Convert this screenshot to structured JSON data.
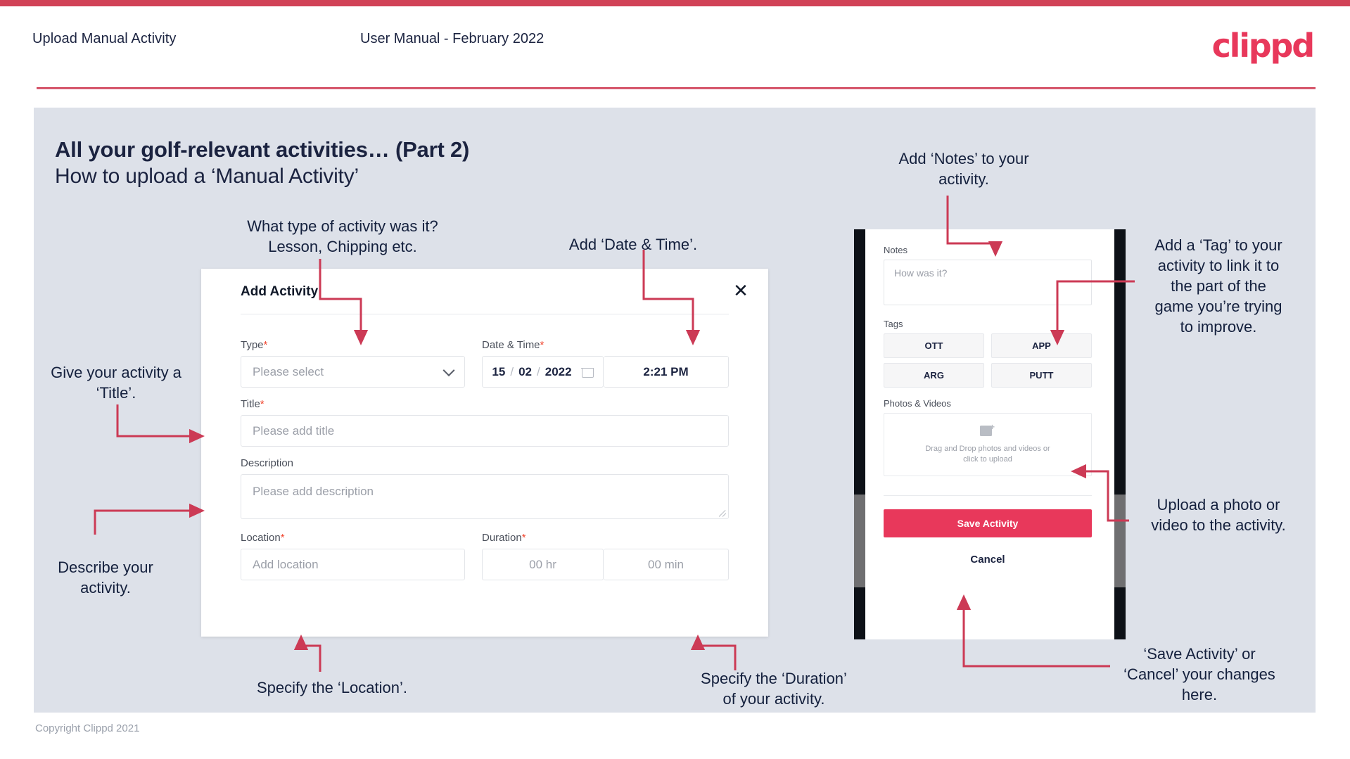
{
  "header": {
    "title": "Upload Manual Activity",
    "subtitle": "User Manual - February 2022",
    "logo": "clippd"
  },
  "slide": {
    "title": "All your golf-relevant activities… (Part 2)",
    "subtitle": "How to upload a ‘Manual Activity’",
    "copyright": "Copyright Clippd 2021"
  },
  "colors": {
    "brand_pink": "#e8385b",
    "rule_red": "#d14257",
    "slide_bg": "#dde1e9",
    "text_dark": "#1b2340",
    "required_star": "#f0452e"
  },
  "dialog": {
    "title": "Add Activity",
    "close_icon": "close-icon",
    "fields": {
      "type": {
        "label": "Type",
        "required": "*",
        "placeholder": "Please select",
        "chevron_icon": "chevron-down-icon"
      },
      "datetime": {
        "label": "Date & Time",
        "required": "*",
        "day": "15",
        "month": "02",
        "year": "2022",
        "sep": "/",
        "calendar_icon": "calendar-icon",
        "time": "2:21 PM"
      },
      "title": {
        "label": "Title",
        "required": "*",
        "placeholder": "Please add title"
      },
      "description": {
        "label": "Description",
        "required": "",
        "placeholder": "Please add description"
      },
      "location": {
        "label": "Location",
        "required": "*",
        "placeholder": "Add location"
      },
      "duration": {
        "label": "Duration",
        "required": "*",
        "hours_placeholder": "00 hr",
        "minutes_placeholder": "00 min"
      }
    }
  },
  "phone": {
    "notes": {
      "label": "Notes",
      "placeholder": "How was it?"
    },
    "tags": {
      "label": "Tags",
      "items": [
        "OTT",
        "APP",
        "ARG",
        "PUTT"
      ]
    },
    "photos": {
      "label": "Photos & Videos",
      "icon": "add-image-icon",
      "dropzone_line1": "Drag and Drop photos and videos or",
      "dropzone_line2": "click to upload"
    },
    "save_label": "Save Activity",
    "cancel_label": "Cancel"
  },
  "annotations": {
    "type": "What type of activity was it?\nLesson, Chipping etc.",
    "datetime": "Add ‘Date & Time’.",
    "title": "Give your activity a\n‘Title’.",
    "description": "Describe your\nactivity.",
    "location": "Specify the ‘Location’.",
    "duration": "Specify the ‘Duration’\nof your activity.",
    "notes": "Add ‘Notes’ to your\nactivity.",
    "tags": "Add a ‘Tag’ to your\nactivity to link it to\nthe part of the\ngame you’re trying\nto improve.",
    "photos": "Upload a photo or\nvideo to the activity.",
    "save": "‘Save Activity’ or\n‘Cancel’ your changes\nhere."
  }
}
